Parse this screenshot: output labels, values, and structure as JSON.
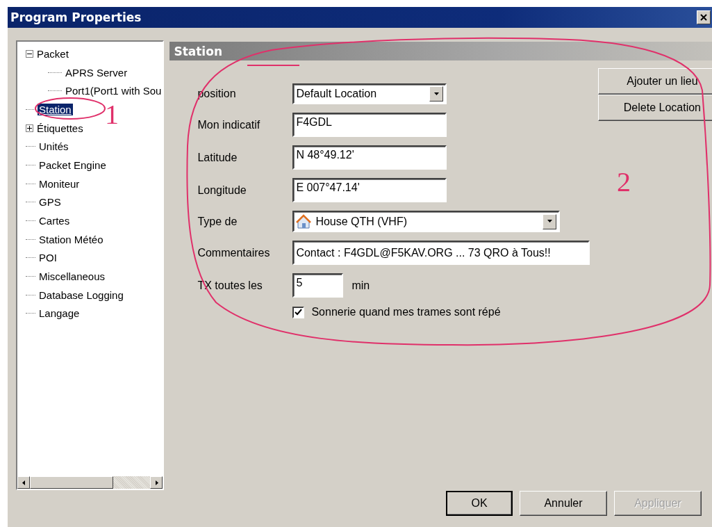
{
  "window": {
    "title": "Program Properties"
  },
  "tree": [
    {
      "label": "Packet",
      "expanded": true,
      "selected": false,
      "children": [
        {
          "label": "APRS Server",
          "selected": false
        },
        {
          "label": "Port1(Port1 with Sou",
          "selected": false
        }
      ]
    },
    {
      "label": "Station",
      "selected": true
    },
    {
      "label": "Étiquettes",
      "expanded": false,
      "selected": false
    },
    {
      "label": "Unités",
      "selected": false
    },
    {
      "label": "Packet Engine",
      "selected": false
    },
    {
      "label": "Moniteur",
      "selected": false
    },
    {
      "label": "GPS",
      "selected": false
    },
    {
      "label": "Cartes",
      "selected": false
    },
    {
      "label": "Station Météo",
      "selected": false
    },
    {
      "label": "POI",
      "selected": false
    },
    {
      "label": "Miscellaneous",
      "selected": false
    },
    {
      "label": "Database Logging",
      "selected": false
    },
    {
      "label": "Langage",
      "selected": false
    }
  ],
  "panel": {
    "title": "Station",
    "side_buttons": [
      "Ajouter un lieu",
      "Delete Location"
    ],
    "fields": [
      {
        "kind": "combo",
        "label": "position",
        "value": "Default Location"
      },
      {
        "kind": "text",
        "label": "Mon indicatif",
        "value": "F4GDL"
      },
      {
        "kind": "text",
        "label": "Latitude",
        "value": "N 48°49.12'"
      },
      {
        "kind": "text",
        "label": "Longitude",
        "value": "E 007°47.14'"
      },
      {
        "kind": "icon-combo",
        "label": "Type de",
        "value": "House QTH (VHF)"
      },
      {
        "kind": "wide-text",
        "label": "Commentaires",
        "value": "Contact : F4GDL@F5KAV.ORG ... 73 QRO à Tous!!"
      },
      {
        "kind": "number",
        "label": "TX toutes les",
        "value": "5",
        "unit": "min"
      }
    ],
    "checkbox": {
      "label": "Sonnerie quand mes trames sont répé",
      "checked": true
    }
  },
  "buttons": [
    {
      "label": "OK",
      "default": true,
      "disabled": false
    },
    {
      "label": "Annuler",
      "default": false,
      "disabled": false
    },
    {
      "label": "Appliquer",
      "default": false,
      "disabled": true
    }
  ],
  "annotations": [
    {
      "text": "1"
    },
    {
      "text": "2"
    }
  ]
}
